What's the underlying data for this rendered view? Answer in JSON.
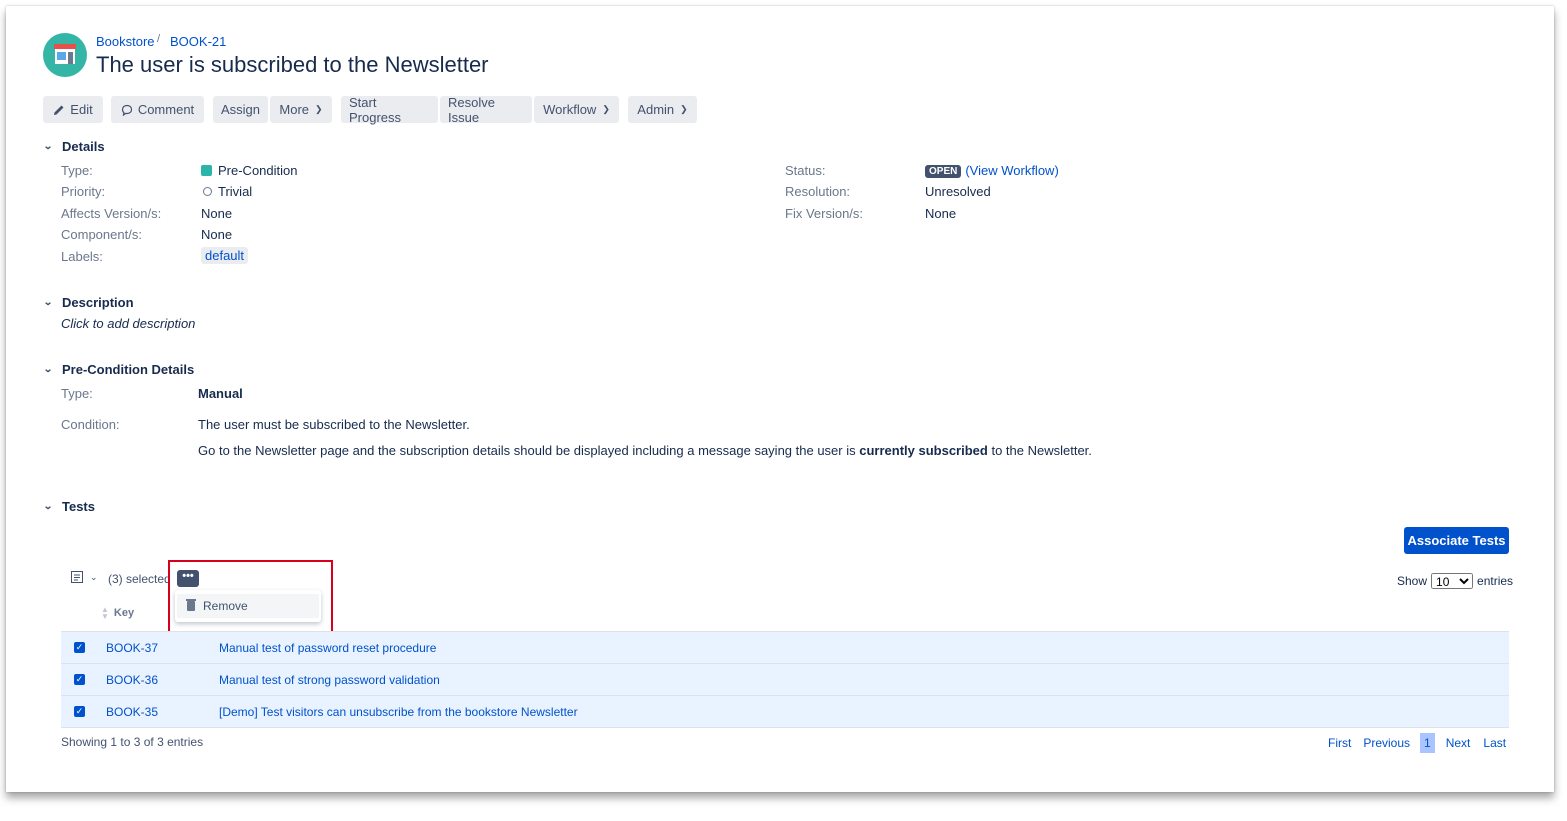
{
  "breadcrumb": {
    "project": "Bookstore",
    "sep": "/",
    "issue_key": "BOOK-21"
  },
  "issue": {
    "title": "The user is subscribed to the Newsletter"
  },
  "toolbar": {
    "edit": "Edit",
    "comment": "Comment",
    "assign": "Assign",
    "more": "More",
    "start_progress": "Start Progress",
    "resolve_issue": "Resolve Issue",
    "workflow": "Workflow",
    "admin": "Admin"
  },
  "details": {
    "heading": "Details",
    "type_label": "Type:",
    "type_value": "Pre-Condition",
    "priority_label": "Priority:",
    "priority_value": "Trivial",
    "affects_label": "Affects Version/s:",
    "affects_value": "None",
    "component_label": "Component/s:",
    "component_value": "None",
    "labels_label": "Labels:",
    "labels_value": "default",
    "status_label": "Status:",
    "status_value": "OPEN",
    "view_workflow": "(View Workflow)",
    "resolution_label": "Resolution:",
    "resolution_value": "Unresolved",
    "fix_label": "Fix Version/s:",
    "fix_value": "None"
  },
  "description": {
    "heading": "Description",
    "placeholder": "Click to add description"
  },
  "precondition": {
    "heading": "Pre-Condition Details",
    "type_label": "Type:",
    "type_value": "Manual",
    "condition_label": "Condition:",
    "condition_line1": "The user must be subscribed to the Newsletter.",
    "condition_line2_pre": "Go to the Newsletter page and the subscription details should be displayed including a message saying the user is ",
    "condition_line2_bold": "currently subscribed",
    "condition_line2_post": " to the Newsletter."
  },
  "tests": {
    "heading": "Tests",
    "associate_button": "Associate Tests",
    "selected_text": "(3) selected",
    "dots_label": "•••",
    "menu_remove": "Remove",
    "key_header": "Key",
    "show_label": "Show",
    "show_value": "10",
    "entries_label": "entries",
    "rows": [
      {
        "key": "BOOK-37",
        "summary": "Manual test of password reset procedure"
      },
      {
        "key": "BOOK-36",
        "summary": "Manual test of strong password validation"
      },
      {
        "key": "BOOK-35",
        "summary": "[Demo] Test visitors can unsubscribe from the bookstore Newsletter"
      }
    ],
    "showing_text": "Showing 1 to 3 of 3 entries",
    "pager": {
      "first": "First",
      "previous": "Previous",
      "current": "1",
      "next": "Next",
      "last": "Last"
    }
  },
  "colors": {
    "primary": "#0052cc",
    "highlight_box": "#d6001c",
    "row_selected": "#e9f2ff",
    "avatar": "#34b5a6"
  }
}
